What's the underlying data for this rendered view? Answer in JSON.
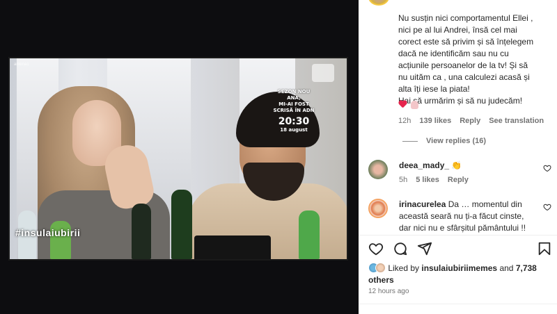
{
  "post": {
    "tv_channel_tag": "antena1",
    "tv_logo_text": "#insulaiubirii",
    "tv_promo_line1": "SEZON NOU",
    "tv_promo_line2": "ANA,",
    "tv_promo_line3": "MI-AI FOST",
    "tv_promo_line4": "SCRISĂ ÎN ADN",
    "tv_promo_time": "20:30",
    "tv_promo_date": "18 august"
  },
  "main_comment": {
    "line1": "Nu susțin nici comportamentul Ellei ,",
    "line2": "nici pe al lui Andrei, însă cel mai",
    "line3": "corect este să privim și să înțelegem",
    "line4": "dacă ne identificăm sau nu cu",
    "line5": "acțiunile persoanelor de la tv! Și să",
    "line6": "nu uităm ca , una calculezi acasă și",
    "line7": "alta îți iese la piata!",
    "line8": "Hai să urmărim și să nu judecăm!",
    "time": "12h",
    "likes": "139 likes",
    "reply_label": "Reply",
    "translate_label": "See translation",
    "view_replies": "View replies (16)"
  },
  "replies": [
    {
      "username": "deea_mady_",
      "text": "👏",
      "time": "5h",
      "likes": "5 likes",
      "reply_label": "Reply"
    },
    {
      "username": "irinacurelea",
      "text_line1": "Da … momentul din",
      "text_line2": "această seară nu ți-a făcut cinste,",
      "text_line3": "dar nici nu e sfârșitul pământului !!"
    }
  ],
  "footer": {
    "liked_by_prefix": "Liked by",
    "liked_by_user": "insulaiubiriimemes",
    "liked_by_and": "and",
    "liked_by_count": "7,738",
    "liked_by_others": "others",
    "time_ago": "12 hours ago"
  },
  "icons": [
    "like-icon",
    "comment-icon",
    "share-icon",
    "save-icon",
    "heart-icon"
  ],
  "colors": {
    "text": "#262626",
    "secondary": "#737373",
    "heart": "#e6254d"
  }
}
